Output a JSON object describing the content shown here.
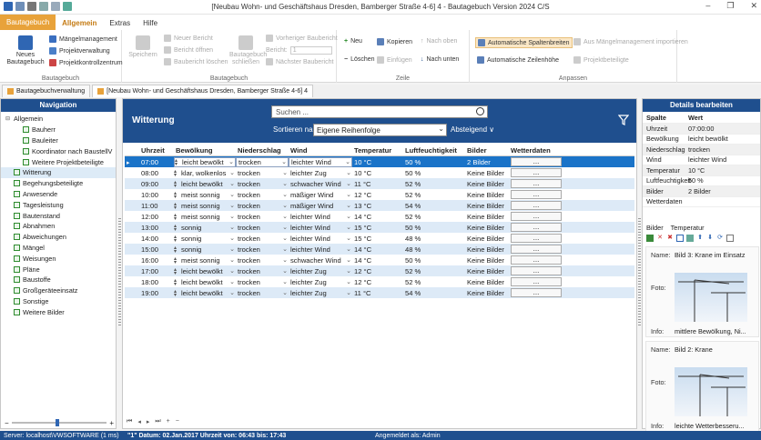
{
  "window": {
    "title": "[Neubau Wohn- und Geschäftshaus Dresden, Bamberger Straße 4-6] 4 - Bautagebuch Version 2024 C/S"
  },
  "ribbon_tabs": [
    "Bautagebuch",
    "Allgemein",
    "Extras",
    "Hilfe"
  ],
  "ribbon": {
    "bautagebuch": {
      "label": "Bautagebuch",
      "neues": "Neues Bautagebuch",
      "maengel": "Mängelmanagement",
      "projekt": "Projektverwaltung",
      "kontroll": "Projektkontrollzentrum"
    },
    "bericht": {
      "label": "Bautagebuch",
      "speichern": "Speichern",
      "neuer": "Neuer Bericht",
      "oeffnen": "Bericht öffnen",
      "loeschen": "Baubericht löschen",
      "schliessen": "Bautagebuch schließen",
      "vorheriger": "Vorheriger Baubericht",
      "bericht_lbl": "Bericht:",
      "bericht_val": "1",
      "naechster": "Nächster Baubericht"
    },
    "zeile": {
      "label": "Zeile",
      "neu": "Neu",
      "loeschen": "Löschen",
      "kopieren": "Kopieren",
      "einfuegen": "Einfügen",
      "oben": "Nach oben",
      "unten": "Nach unten"
    },
    "anpassen": {
      "label": "Anpassen",
      "spalten": "Automatische Spaltenbreiten",
      "zeilen": "Automatische Zeilenhöhe",
      "import": "Aus Mängelmanagement importieren",
      "beteiligte": "Projektbeteiligte"
    }
  },
  "doctabs": [
    "Bautagebuchverwaltung",
    "[Neubau Wohn- und Geschäftshaus Dresden, Bamberger Straße 4-6] 4"
  ],
  "navigation": {
    "title": "Navigation",
    "items": [
      {
        "label": "Allgemein",
        "level": 0,
        "exp": "⊟",
        "cb": false
      },
      {
        "label": "Bauherr",
        "level": 1,
        "cb": true
      },
      {
        "label": "Bauleiter",
        "level": 1,
        "cb": true
      },
      {
        "label": "Koordinator nach BaustellV",
        "level": 1,
        "cb": true
      },
      {
        "label": "Weitere Projektbeteiligte",
        "level": 1,
        "cb": true
      },
      {
        "label": "Witterung",
        "level": 0,
        "cb": true,
        "sel": true
      },
      {
        "label": "Begehungsbeteiligte",
        "level": 0,
        "cb": true
      },
      {
        "label": "Anwesende",
        "level": 0,
        "cb": true
      },
      {
        "label": "Tagesleistung",
        "level": 0,
        "cb": true
      },
      {
        "label": "Bautenstand",
        "level": 0,
        "cb": true
      },
      {
        "label": "Abnahmen",
        "level": 0,
        "cb": true
      },
      {
        "label": "Abweichungen",
        "level": 0,
        "cb": true
      },
      {
        "label": "Mängel",
        "level": 0,
        "cb": true
      },
      {
        "label": "Weisungen",
        "level": 0,
        "cb": true
      },
      {
        "label": "Pläne",
        "level": 0,
        "cb": true
      },
      {
        "label": "Baustoffe",
        "level": 0,
        "cb": true
      },
      {
        "label": "Großgeräteeinsatz",
        "level": 0,
        "cb": true
      },
      {
        "label": "Sonstige",
        "level": 0,
        "cb": true
      },
      {
        "label": "Weitere Bilder",
        "level": 0,
        "cb": true
      }
    ]
  },
  "main": {
    "title": "Witterung",
    "search_placeholder": "Suchen ...",
    "sort_label": "Sortieren nach",
    "sort_value": "Eigene Reihenfolge",
    "sort_dir": "Absteigend ∨",
    "columns": [
      "Uhrzeit",
      "Bewölkung",
      "Niederschlag",
      "Wind",
      "Temperatur",
      "Luftfeuchtigkeit",
      "Bilder",
      "Wetterdaten"
    ],
    "rows": [
      [
        "07:00",
        "leicht bewölkt",
        "trocken",
        "leichter Wind",
        "10 °C",
        "50 %",
        "2 Bilder",
        "..."
      ],
      [
        "08:00",
        "klar, wolkenlos",
        "trocken",
        "leichter Zug",
        "10 °C",
        "50 %",
        "Keine Bilder",
        "..."
      ],
      [
        "09:00",
        "leicht bewölkt",
        "trocken",
        "schwacher Wind",
        "11 °C",
        "52 %",
        "Keine Bilder",
        "..."
      ],
      [
        "10:00",
        "meist sonnig",
        "trocken",
        "mäßiger Wind",
        "12 °C",
        "52 %",
        "Keine Bilder",
        "..."
      ],
      [
        "11:00",
        "meist sonnig",
        "trocken",
        "mäßiger Wind",
        "13 °C",
        "54 %",
        "Keine Bilder",
        "..."
      ],
      [
        "12:00",
        "meist sonnig",
        "trocken",
        "leichter Wind",
        "14 °C",
        "52 %",
        "Keine Bilder",
        "..."
      ],
      [
        "13:00",
        "sonnig",
        "trocken",
        "leichter Wind",
        "15 °C",
        "50 %",
        "Keine Bilder",
        "..."
      ],
      [
        "14:00",
        "sonnig",
        "trocken",
        "leichter Wind",
        "15 °C",
        "48 %",
        "Keine Bilder",
        "..."
      ],
      [
        "15:00",
        "sonnig",
        "trocken",
        "leichter Wind",
        "14 °C",
        "48 %",
        "Keine Bilder",
        "..."
      ],
      [
        "16:00",
        "meist sonnig",
        "trocken",
        "schwacher Wind",
        "14 °C",
        "50 %",
        "Keine Bilder",
        "..."
      ],
      [
        "17:00",
        "leicht bewölkt",
        "trocken",
        "leichter Zug",
        "12 °C",
        "52 %",
        "Keine Bilder",
        "..."
      ],
      [
        "18:00",
        "leicht bewölkt",
        "trocken",
        "leichter Zug",
        "12 °C",
        "52 %",
        "Keine Bilder",
        "..."
      ],
      [
        "19:00",
        "leicht bewölkt",
        "trocken",
        "leichter Zug",
        "11 °C",
        "54 %",
        "Keine Bilder",
        "..."
      ]
    ]
  },
  "details": {
    "title": "Details bearbeiten",
    "col_spalte": "Spalte",
    "col_wert": "Wert",
    "rows": [
      [
        "Uhrzeit",
        "07:00:00"
      ],
      [
        "Bewölkung",
        "leicht bewölkt"
      ],
      [
        "Niederschlag",
        "trocken"
      ],
      [
        "Wind",
        "leichter Wind"
      ],
      [
        "Temperatur",
        "10 °C"
      ],
      [
        "Luftfeuchtigkeit",
        "50 %"
      ],
      [
        "Bilder",
        "2 Bilder"
      ],
      [
        "Wetterdaten",
        ""
      ]
    ],
    "tab_bilder": "Bilder",
    "tab_temp": "Temperatur",
    "images": [
      {
        "name_lbl": "Name:",
        "name": "Bild 3: Krane im Einsatz",
        "foto_lbl": "Foto:",
        "info_lbl": "Info:",
        "info": "mittlere Bewölkung, Ni..."
      },
      {
        "name_lbl": "Name:",
        "name": "Bild 2: Krane",
        "foto_lbl": "Foto:",
        "info_lbl": "Info:",
        "info": "leichte Wetterbesseru..."
      }
    ]
  },
  "status": {
    "server": "Server: localhost\\VWSOFTWARE (1 ms)",
    "datum": "\"1\" Datum: 02.Jan.2017 Uhrzeit von: 06:43 bis: 17:43",
    "user": "Angemeldet als: Admin"
  }
}
